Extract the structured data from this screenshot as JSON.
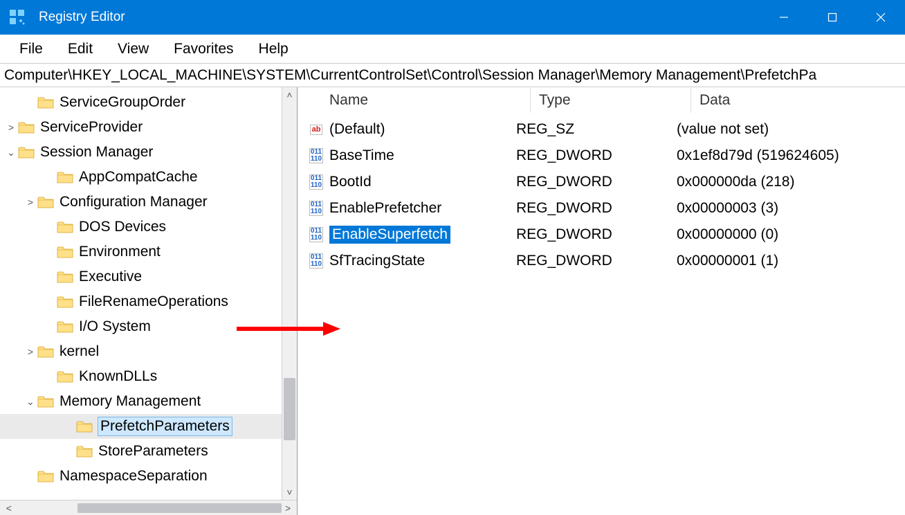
{
  "title": "Registry Editor",
  "menus": [
    "File",
    "Edit",
    "View",
    "Favorites",
    "Help"
  ],
  "address": "Computer\\HKEY_LOCAL_MACHINE\\SYSTEM\\CurrentControlSet\\Control\\Session Manager\\Memory Management\\PrefetchPa",
  "tree": [
    {
      "indent": 1,
      "expander": "",
      "label": "ServiceGroupOrder"
    },
    {
      "indent": 0,
      "expander": ">",
      "label": "ServiceProvider"
    },
    {
      "indent": 0,
      "expander": "v",
      "label": "Session Manager"
    },
    {
      "indent": 2,
      "expander": "",
      "label": "AppCompatCache"
    },
    {
      "indent": 1,
      "expander": ">",
      "label": "Configuration Manager"
    },
    {
      "indent": 2,
      "expander": "",
      "label": "DOS Devices"
    },
    {
      "indent": 2,
      "expander": "",
      "label": "Environment"
    },
    {
      "indent": 2,
      "expander": "",
      "label": "Executive"
    },
    {
      "indent": 2,
      "expander": "",
      "label": "FileRenameOperations"
    },
    {
      "indent": 2,
      "expander": "",
      "label": "I/O System"
    },
    {
      "indent": 1,
      "expander": ">",
      "label": "kernel"
    },
    {
      "indent": 2,
      "expander": "",
      "label": "KnownDLLs"
    },
    {
      "indent": 1,
      "expander": "v",
      "label": "Memory Management"
    },
    {
      "indent": 3,
      "expander": "",
      "label": "PrefetchParameters",
      "selected": true
    },
    {
      "indent": 3,
      "expander": "",
      "label": "StoreParameters"
    },
    {
      "indent": 1,
      "expander": "",
      "label": "NamespaceSeparation"
    }
  ],
  "columns": {
    "name": "Name",
    "type": "Type",
    "data": "Data"
  },
  "values": [
    {
      "icon": "sz",
      "name": "(Default)",
      "type": "REG_SZ",
      "data": "(value not set)"
    },
    {
      "icon": "dw",
      "name": "BaseTime",
      "type": "REG_DWORD",
      "data": "0x1ef8d79d (519624605)"
    },
    {
      "icon": "dw",
      "name": "BootId",
      "type": "REG_DWORD",
      "data": "0x000000da (218)"
    },
    {
      "icon": "dw",
      "name": "EnablePrefetcher",
      "type": "REG_DWORD",
      "data": "0x00000003 (3)"
    },
    {
      "icon": "dw",
      "name": "EnableSuperfetch",
      "type": "REG_DWORD",
      "data": "0x00000000 (0)",
      "selected": true
    },
    {
      "icon": "dw",
      "name": "SfTracingState",
      "type": "REG_DWORD",
      "data": "0x00000001 (1)"
    }
  ]
}
